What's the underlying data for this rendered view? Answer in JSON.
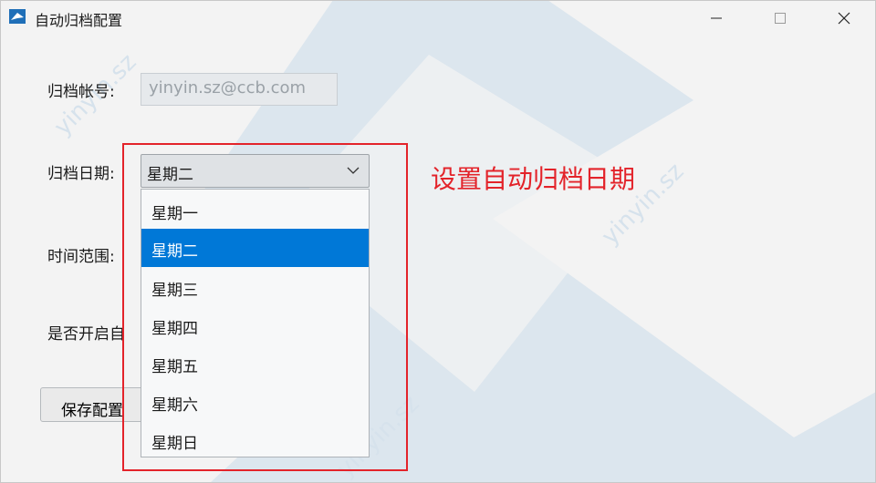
{
  "window": {
    "title": "自动归档配置"
  },
  "form": {
    "account_label": "归档帐号:",
    "account_value": "yinyin.sz@ccb.com",
    "date_label": "归档日期:",
    "date_selected": "星期二",
    "date_options": [
      "星期一",
      "星期二",
      "星期三",
      "星期四",
      "星期五",
      "星期六",
      "星期日"
    ],
    "time_range_label": "时间范围:",
    "auto_enable_label": "是否开启自",
    "save_label": "保存配置"
  },
  "annotation": {
    "text": "设置自动归档日期",
    "color": "#e3232a"
  },
  "watermark": {
    "text": "yinyin.sz"
  },
  "colors": {
    "selection": "#0078d7",
    "watermark_shape": "#c5d7e8"
  }
}
